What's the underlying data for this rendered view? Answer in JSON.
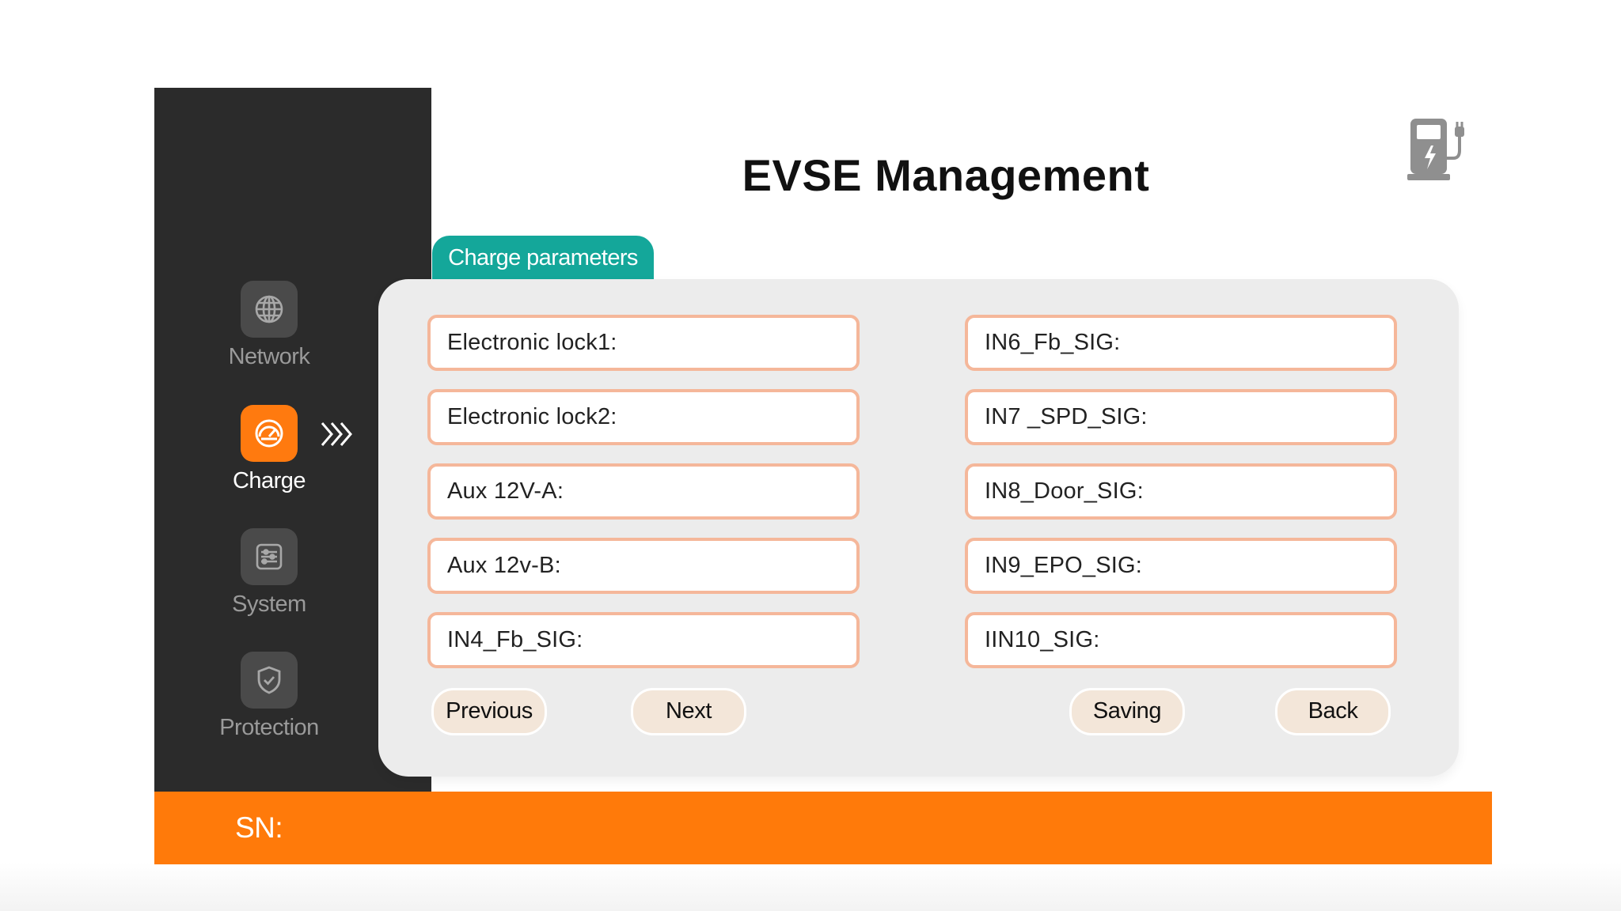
{
  "header": {
    "title": "EVSE Management",
    "icon": "ev-charger-icon"
  },
  "sidebar": {
    "items": [
      {
        "label": "Network",
        "icon": "globe-icon",
        "active": false
      },
      {
        "label": "Charge",
        "icon": "charge-gauge-icon",
        "active": true
      },
      {
        "label": "System",
        "icon": "settings-list-icon",
        "active": false
      },
      {
        "label": "Protection",
        "icon": "shield-check-icon",
        "active": false
      }
    ]
  },
  "tab": {
    "label": "Charge parameters"
  },
  "fields": {
    "left": [
      {
        "label": "Electronic lock1:"
      },
      {
        "label": "Electronic lock2:"
      },
      {
        "label": "Aux 12V-A:"
      },
      {
        "label": "Aux 12v-B:"
      },
      {
        "label": "IN4_Fb_SIG:"
      }
    ],
    "right": [
      {
        "label": "IN6_Fb_SIG:"
      },
      {
        "label": "IN7 _SPD_SIG:"
      },
      {
        "label": "IN8_Door_SIG:"
      },
      {
        "label": "IN9_EPO_SIG:"
      },
      {
        "label": "IIN10_SIG:"
      }
    ]
  },
  "buttons": {
    "previous": "Previous",
    "next": "Next",
    "saving": "Saving",
    "back": "Back"
  },
  "status": {
    "sn_label": "SN:"
  },
  "colors": {
    "sidebar": "#2b2b2b",
    "accent_orange": "#ff7a0a",
    "tab_teal": "#14a79a",
    "field_border": "#f5b79a",
    "button_bg": "#f3e6d9",
    "panel_bg": "#ececec"
  }
}
